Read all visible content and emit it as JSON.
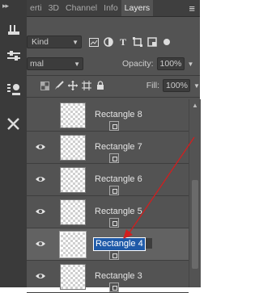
{
  "tabs": [
    {
      "label": "erti",
      "active": false
    },
    {
      "label": "3D",
      "active": false
    },
    {
      "label": "Channel",
      "active": false
    },
    {
      "label": "Info",
      "active": false
    },
    {
      "label": "Layers",
      "active": true
    }
  ],
  "filter": {
    "kind_label": "Kind"
  },
  "blend": {
    "mode": "mal",
    "opacity_label": "Opacity:",
    "opacity_value": "100%"
  },
  "lock": {
    "fill_label": "Fill:",
    "fill_value": "100%"
  },
  "layers": [
    {
      "name": "Rectangle 8",
      "visible": false,
      "selected": false,
      "editing": false
    },
    {
      "name": "Rectangle 7",
      "visible": true,
      "selected": false,
      "editing": false
    },
    {
      "name": "Rectangle 6",
      "visible": true,
      "selected": false,
      "editing": false
    },
    {
      "name": "Rectangle 5",
      "visible": true,
      "selected": false,
      "editing": false
    },
    {
      "name": "Rectangle 4",
      "visible": true,
      "selected": true,
      "editing": true
    },
    {
      "name": "Rectangle 3",
      "visible": true,
      "selected": false,
      "editing": false
    }
  ],
  "colors": {
    "annotation_arrow": "#d21e1e",
    "selection": "#1f5aa8"
  }
}
